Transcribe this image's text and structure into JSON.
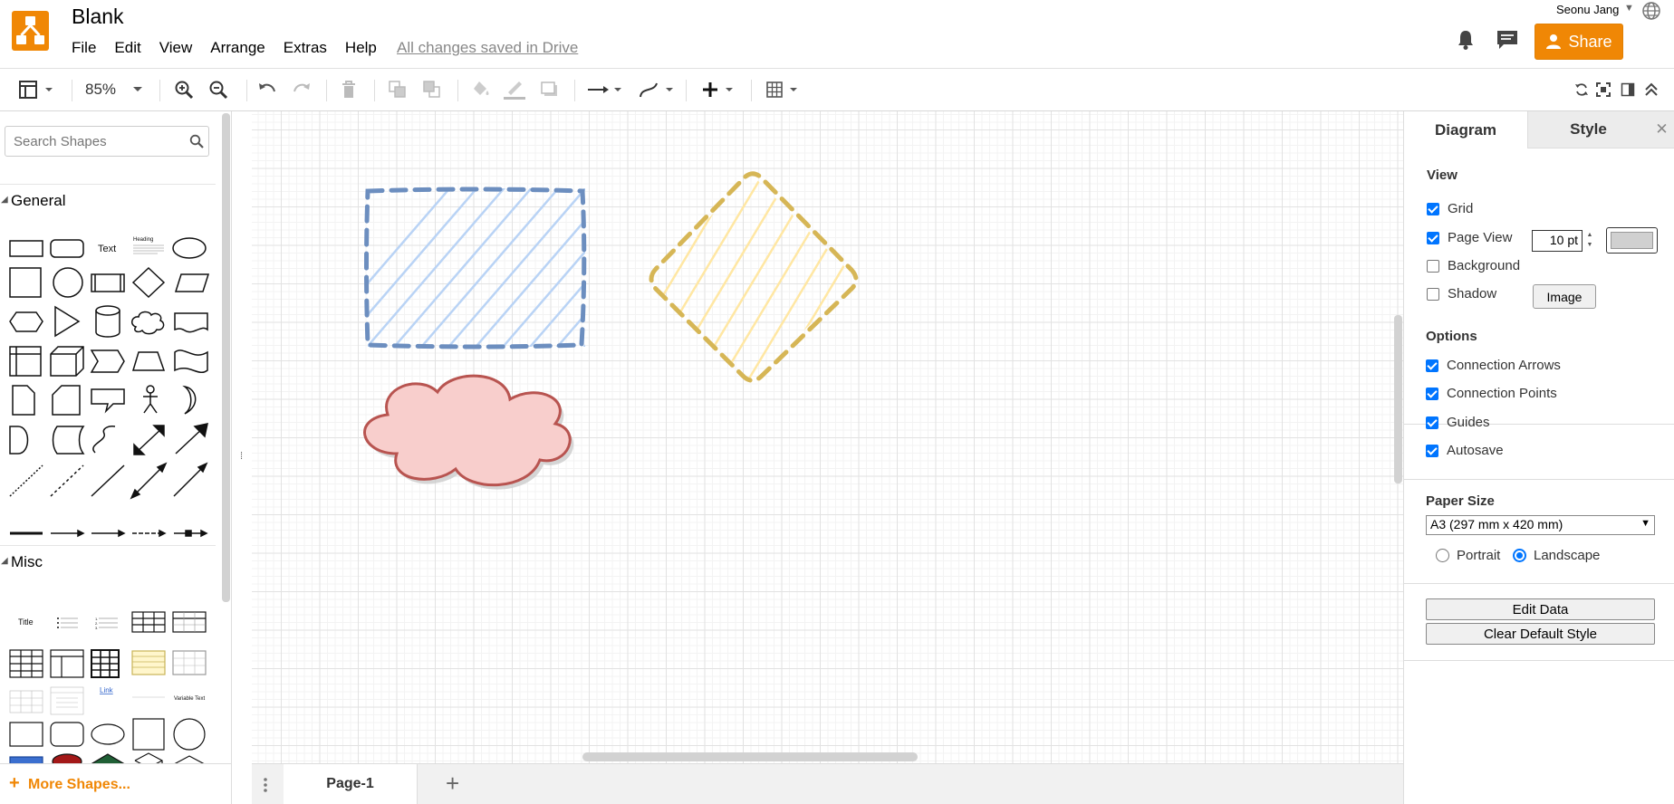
{
  "app": {
    "title": "Blank",
    "save_status": "All changes saved in Drive",
    "user_name": "Seonu Jang",
    "share_label": "Share",
    "accent_color": "#f08705"
  },
  "menu": [
    "File",
    "Edit",
    "View",
    "Arrange",
    "Extras",
    "Help"
  ],
  "toolbar": {
    "zoom": "85%",
    "icons": [
      "format-panel-icon",
      "zoom-in-icon",
      "zoom-out-icon",
      "undo-icon",
      "redo-icon",
      "delete-icon",
      "to-front-icon",
      "to-back-icon",
      "fill-color-icon",
      "line-color-icon",
      "shadow-icon",
      "connection-icon",
      "waypoints-icon",
      "insert-icon",
      "table-icon",
      "reset-view-icon",
      "fit-icon",
      "panel-toggle-icon",
      "collapse-icon"
    ]
  },
  "sidebar": {
    "search_placeholder": "Search Shapes",
    "sections": [
      "General",
      "Misc"
    ],
    "general_text_shape": "Text",
    "general_heading_shape": "Heading",
    "misc_labels": [
      "Title",
      "Link",
      "Variable Text"
    ],
    "more_shapes": "More Shapes..."
  },
  "canvas": {
    "shapes": [
      {
        "type": "rectangle",
        "fill": "#dae8fc",
        "stroke": "#6c8ebf",
        "style": "dashed hachure"
      },
      {
        "type": "rhombus",
        "fill": "#fff2cc",
        "stroke": "#d6b656",
        "style": "dashed hachure"
      },
      {
        "type": "cloud",
        "fill": "#f8cecc",
        "stroke": "#b85450",
        "style": "solid shadow"
      }
    ]
  },
  "pages": {
    "tabs": [
      "Page-1"
    ],
    "add_label": "+"
  },
  "panel": {
    "tabs": [
      "Diagram",
      "Style"
    ],
    "close_label": "✕",
    "view_title": "View",
    "grid_label": "Grid",
    "grid_size": "10 pt",
    "grid_color": "#d0d0d0",
    "page_view_label": "Page View",
    "background_label": "Background",
    "image_button": "Image",
    "shadow_label": "Shadow",
    "options_title": "Options",
    "connection_arrows": "Connection Arrows",
    "connection_points": "Connection Points",
    "guides": "Guides",
    "autosave": "Autosave",
    "paper_title": "Paper Size",
    "paper_value": "A3 (297 mm x 420 mm)",
    "portrait_label": "Portrait",
    "landscape_label": "Landscape",
    "edit_data": "Edit Data",
    "clear_style": "Clear Default Style"
  }
}
